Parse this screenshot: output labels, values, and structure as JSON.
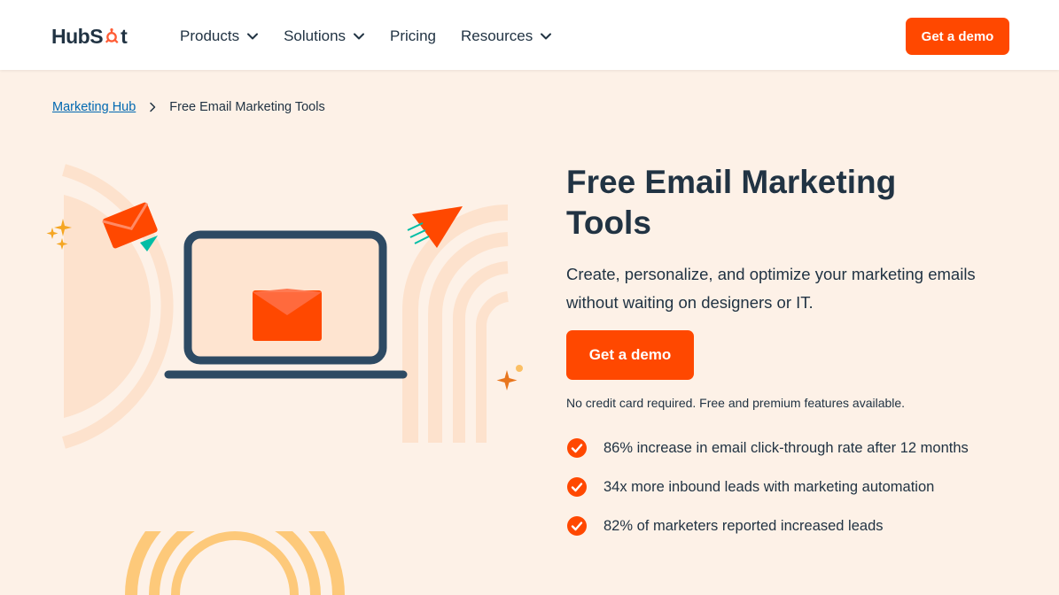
{
  "header": {
    "logo_text_left": "HubS",
    "logo_text_right": "t",
    "nav": [
      {
        "label": "Products",
        "has_dropdown": true
      },
      {
        "label": "Solutions",
        "has_dropdown": true
      },
      {
        "label": "Pricing",
        "has_dropdown": false
      },
      {
        "label": "Resources",
        "has_dropdown": true
      }
    ],
    "cta_label": "Get a demo"
  },
  "breadcrumb": {
    "parent": "Marketing Hub",
    "current": "Free Email Marketing Tools"
  },
  "hero": {
    "title": "Free Email Marketing Tools",
    "subtitle": "Create, personalize, and optimize your marketing emails without waiting on designers or IT.",
    "cta_label": "Get a demo",
    "note": "No credit card required. Free and premium features available.",
    "stats": [
      "86% increase in email click-through rate after 12 months",
      "34x more inbound leads with marketing automation",
      "82% of marketers reported increased leads"
    ]
  },
  "colors": {
    "accent": "#ff4800",
    "text": "#213343",
    "background": "#fdf1e7",
    "link": "#0068b1"
  }
}
